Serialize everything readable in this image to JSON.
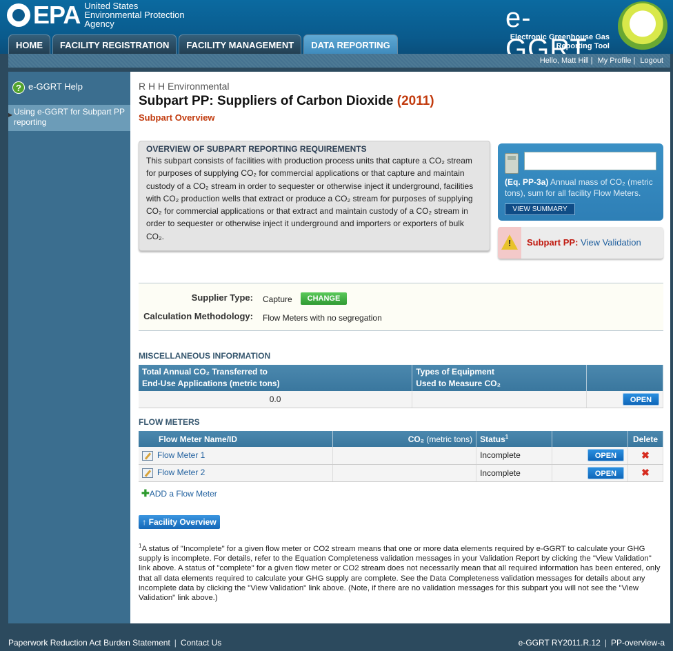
{
  "header": {
    "epa_word": "EPA",
    "agency_line1": "United States",
    "agency_line2": "Environmental Protection",
    "agency_line3": "Agency",
    "ggrt_title": "e-GGRT",
    "ggrt_sub1": "Electronic Greenhouse Gas",
    "ggrt_sub2": "Reporting Tool"
  },
  "nav": {
    "tabs": [
      {
        "label": "HOME"
      },
      {
        "label": "FACILITY REGISTRATION"
      },
      {
        "label": "FACILITY MANAGEMENT"
      },
      {
        "label": "DATA REPORTING"
      }
    ]
  },
  "userbar": {
    "greeting": "Hello, Matt Hill",
    "profile": "My Profile",
    "logout": "Logout"
  },
  "sidebar": {
    "help_label": "e-GGRT Help",
    "help_icon": "?",
    "item_label": "Using e-GGRT for Subpart PP reporting"
  },
  "main": {
    "facility_name": "R H H Environmental",
    "title": "Subpart PP: Suppliers of Carbon Dioxide",
    "year": "(2011)",
    "subtitle": "Subpart Overview",
    "overview": {
      "heading": "OVERVIEW OF SUBPART REPORTING REQUIREMENTS",
      "text": "This subpart consists of facilities with production process units that capture a CO₂ stream for purposes of supplying CO₂ for commercial applications or that capture and maintain custody of a CO₂ stream in order to sequester or otherwise inject it underground, facilities with CO₂ production wells that extract or produce a CO₂ stream for purposes of supplying CO₂ for commercial applications or that extract and maintain custody of a CO₂ stream in order to sequester or otherwise inject it underground and importers or exporters of bulk CO₂."
    },
    "calc": {
      "equation": "(Eq. PP-3a)",
      "description": "Annual mass of CO₂ (metric tons), sum for all facility Flow Meters.",
      "button": "VIEW SUMMARY",
      "value": ""
    },
    "validation": {
      "label": "Subpart PP:",
      "link": "View Validation"
    },
    "supplier": {
      "type_label": "Supplier Type:",
      "type_value": "Capture",
      "change_button": "CHANGE",
      "method_label": "Calculation Methodology:",
      "method_value": "Flow Meters with no segregation"
    },
    "misc": {
      "title": "MISCELLANEOUS INFORMATION",
      "col1": "Total Annual CO₂ Transferred to End-Use Applications (metric tons)",
      "col1_line1": "Total Annual CO₂ Transferred to",
      "col1_line2": "End-Use Applications (metric tons)",
      "col2_line1": "Types of Equipment",
      "col2_line2": "Used to Measure CO₂",
      "value": "0.0",
      "open_button": "OPEN"
    },
    "flow": {
      "title": "FLOW METERS",
      "headers": {
        "name": "Flow Meter Name/ID",
        "co2": "CO₂",
        "co2_unit": "(metric tons)",
        "status": "Status",
        "status_sup": "1",
        "delete": "Delete"
      },
      "rows": [
        {
          "name": "Flow Meter 1",
          "co2": "",
          "status": "Incomplete",
          "open": "OPEN",
          "delete": "✖"
        },
        {
          "name": "Flow Meter 2",
          "co2": "",
          "status": "Incomplete",
          "open": "OPEN",
          "delete": "✖"
        }
      ],
      "add_label": "ADD a Flow Meter"
    },
    "facility_button": "Facility Overview",
    "footnote_sup": "1",
    "footnote": "A status of \"Incomplete\" for a given flow meter or CO2 stream means that one or more data elements required by e-GGRT to calculate your GHG supply is incomplete. For details, refer to the Equation Completeness validation messages in your Validation Report by clicking the \"View Validation\" link above. A status of \"complete\" for a given flow meter or CO2 stream does not necessarily mean that all required information has been entered, only that all data elements required to calculate your GHG supply are complete. See the Data Completeness validation messages for details about any incomplete data by clicking the \"View Validation\" link above. (Note, if there are no validation messages for this subpart you will not see the \"View Validation\" link above.)"
  },
  "footer": {
    "paperwork": "Paperwork Reduction Act Burden Statement",
    "contact": "Contact Us",
    "version": "e-GGRT RY2011.R.12",
    "page_id": "PP-overview-a"
  }
}
